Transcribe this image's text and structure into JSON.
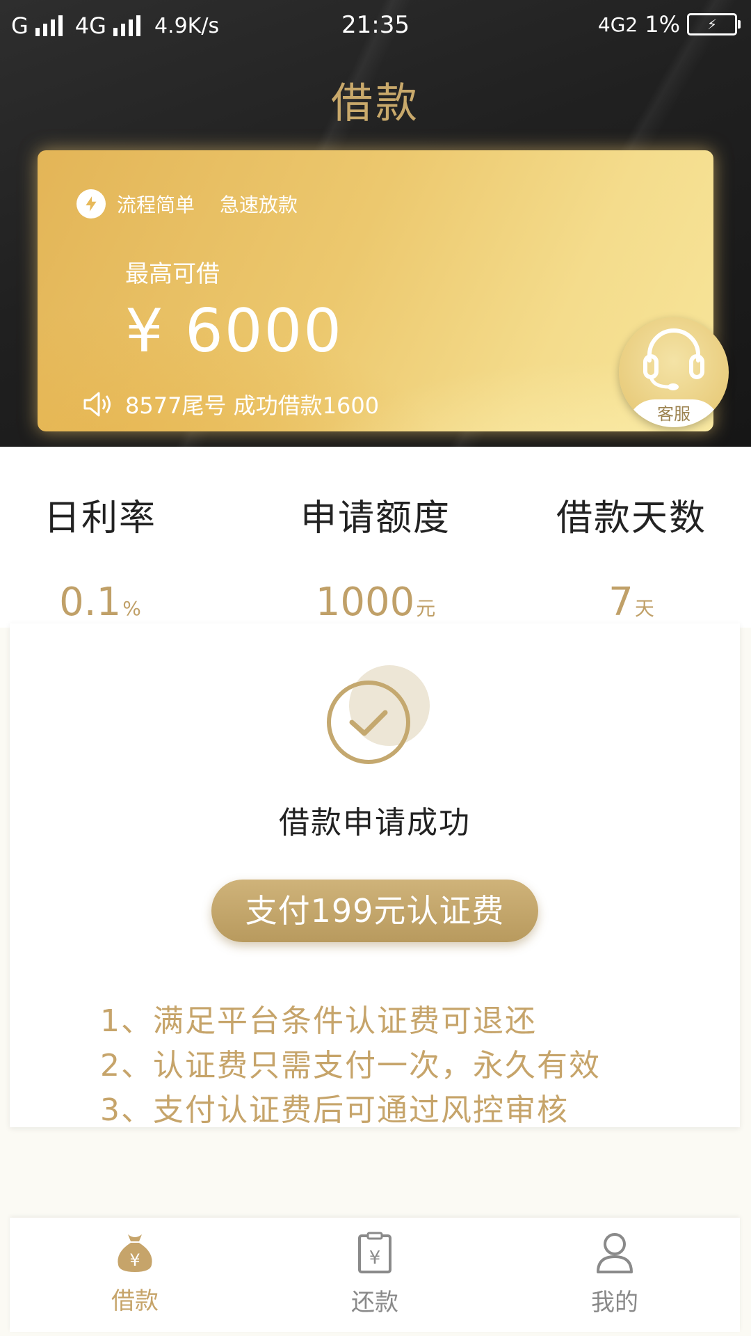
{
  "status_bar": {
    "network_1": "G",
    "network_2": "4G",
    "speed": "4.9K/s",
    "time": "21:35",
    "network_right": "4G2",
    "battery_percent": "1%"
  },
  "header": {
    "title": "借款"
  },
  "promo_card": {
    "tag_1": "流程简单",
    "tag_2": "急速放款",
    "max_label": "最高可借",
    "max_amount": "¥ 6000",
    "notice": "8577尾号 成功借款1600",
    "service_label": "客服"
  },
  "stats": [
    {
      "label": "日利率",
      "value": "0.1",
      "unit": "%"
    },
    {
      "label": "申请额度",
      "value": "1000",
      "unit": "元"
    },
    {
      "label": "借款天数",
      "value": "7",
      "unit": "天"
    }
  ],
  "result": {
    "success_text": "借款申请成功",
    "pay_button": "支付199元认证费",
    "notes": [
      "1、满足平台条件认证费可退还",
      "2、认证费只需支付一次，永久有效",
      "3、支付认证费后可通过风控审核"
    ]
  },
  "tabbar": {
    "items": [
      {
        "label": "借款",
        "icon": "money-bag-icon",
        "active": true
      },
      {
        "label": "还款",
        "icon": "bill-icon",
        "active": false
      },
      {
        "label": "我的",
        "icon": "profile-icon",
        "active": false
      }
    ]
  },
  "colors": {
    "accent_gold": "#c4a86f",
    "header_bg": "#1e1e1e",
    "inactive_gray": "#8a8a8a"
  }
}
